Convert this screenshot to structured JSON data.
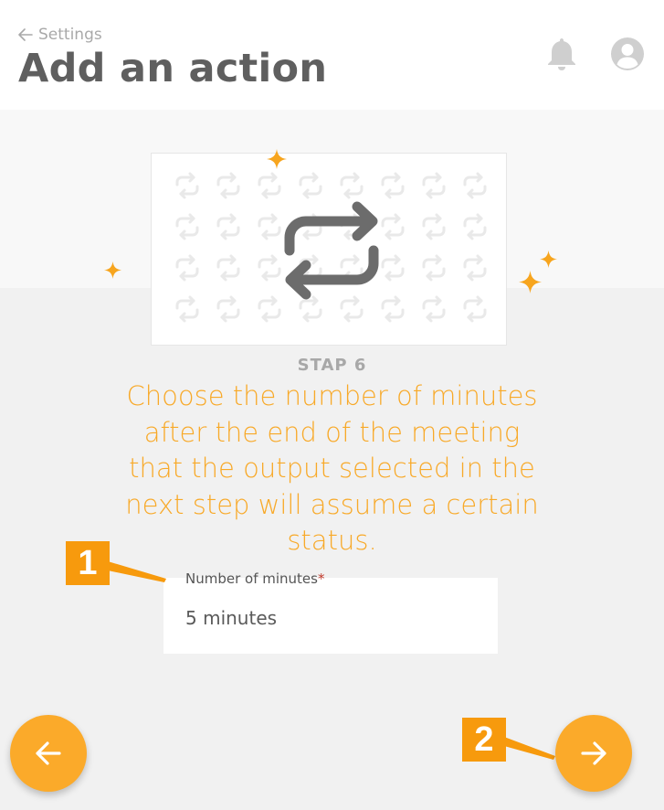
{
  "header": {
    "back_label": "Settings",
    "title": "Add an action"
  },
  "step": {
    "label": "STAP 6",
    "instruction": "Choose the number of minutes after the end of the meeting that the output selected in the next step will assume a certain status."
  },
  "field": {
    "label": "Number of minutes",
    "required_mark": "*",
    "value": "5 minutes"
  },
  "annotations": {
    "badge_1": "1",
    "badge_2": "2"
  },
  "icons": {
    "back": "arrow-left-icon",
    "notifications": "bell-icon",
    "account": "user-avatar-icon",
    "hero": "repeat-icon",
    "prev": "arrow-left-icon",
    "next": "arrow-right-icon",
    "decoration": "sparkle-icon"
  },
  "colors": {
    "accent": "#fbaa2a",
    "instruction_text": "#f8a928",
    "badge": "#f79a0d",
    "title_text": "#5f5f5f",
    "icon_grey": "#cfcfcf"
  }
}
